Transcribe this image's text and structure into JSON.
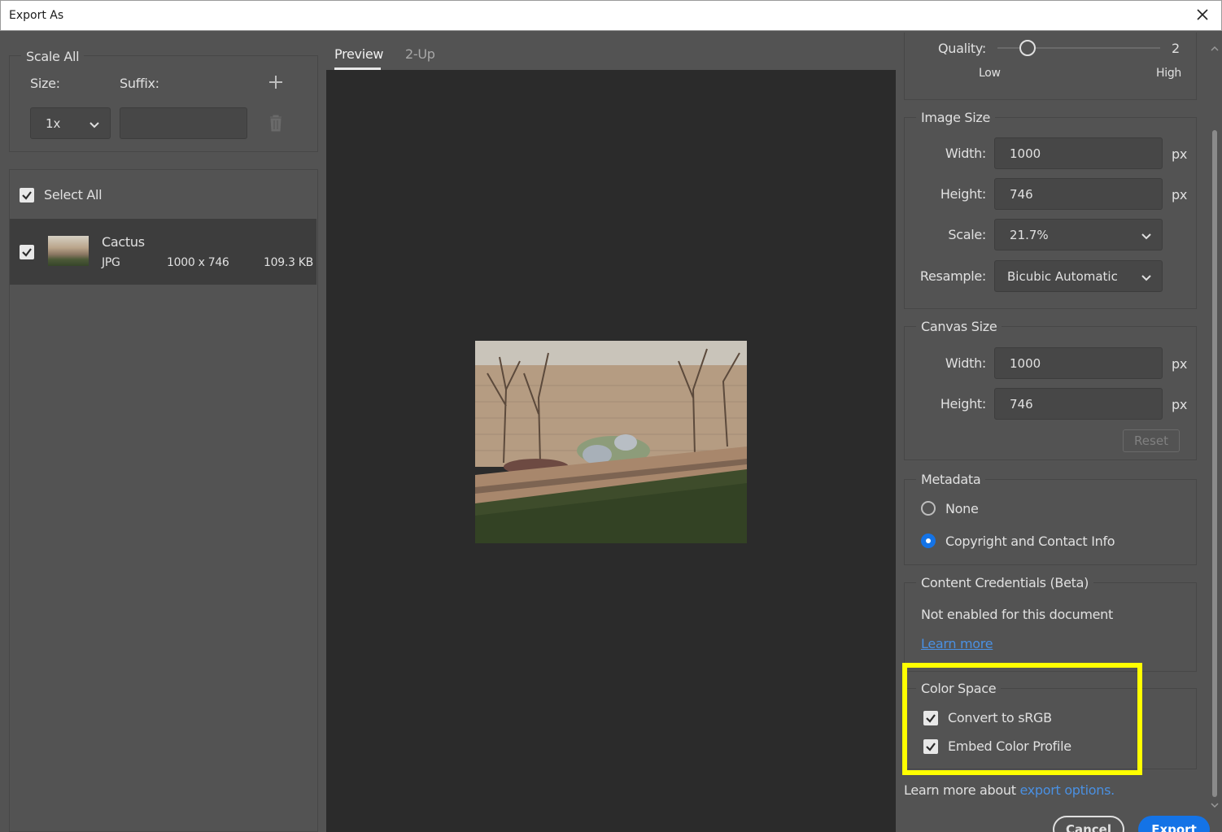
{
  "window": {
    "title": "Export As"
  },
  "scale_all": {
    "legend": "Scale All",
    "size_label": "Size:",
    "suffix_label": "Suffix:",
    "size_value": "1x",
    "suffix_value": ""
  },
  "file_list": {
    "select_all_label": "Select All",
    "select_all_checked": true,
    "items": [
      {
        "name": "Cactus",
        "format": "JPG",
        "dimensions": "1000 x 746",
        "size": "109.3 KB",
        "checked": true
      }
    ]
  },
  "tabs": [
    {
      "label": "Preview",
      "active": true
    },
    {
      "label": "2-Up",
      "active": false
    }
  ],
  "quality": {
    "label": "Quality:",
    "value": "2",
    "low_label": "Low",
    "high_label": "High"
  },
  "image_size": {
    "legend": "Image Size",
    "width_label": "Width:",
    "width_value": "1000",
    "height_label": "Height:",
    "height_value": "746",
    "scale_label": "Scale:",
    "scale_value": "21.7%",
    "resample_label": "Resample:",
    "resample_value": "Bicubic Automatic",
    "unit": "px"
  },
  "canvas_size": {
    "legend": "Canvas Size",
    "width_label": "Width:",
    "width_value": "1000",
    "height_label": "Height:",
    "height_value": "746",
    "unit": "px",
    "reset_label": "Reset"
  },
  "metadata": {
    "legend": "Metadata",
    "options": [
      {
        "label": "None",
        "selected": false
      },
      {
        "label": "Copyright and Contact Info",
        "selected": true
      }
    ]
  },
  "content_credentials": {
    "legend": "Content Credentials (Beta)",
    "status": "Not enabled for this document",
    "link": "Learn more"
  },
  "color_space": {
    "legend": "Color Space",
    "options": [
      {
        "label": "Convert to sRGB",
        "checked": true
      },
      {
        "label": "Embed Color Profile",
        "checked": true
      }
    ]
  },
  "footer": {
    "learn_text": "Learn more about ",
    "learn_link": "export options.",
    "cancel_label": "Cancel",
    "export_label": "Export"
  },
  "colors": {
    "dialog_bg": "#535353",
    "preview_bg": "#2b2b2b",
    "accent_blue": "#1473e6",
    "link_blue": "#4a90e2",
    "highlight_yellow": "#ffff00"
  }
}
